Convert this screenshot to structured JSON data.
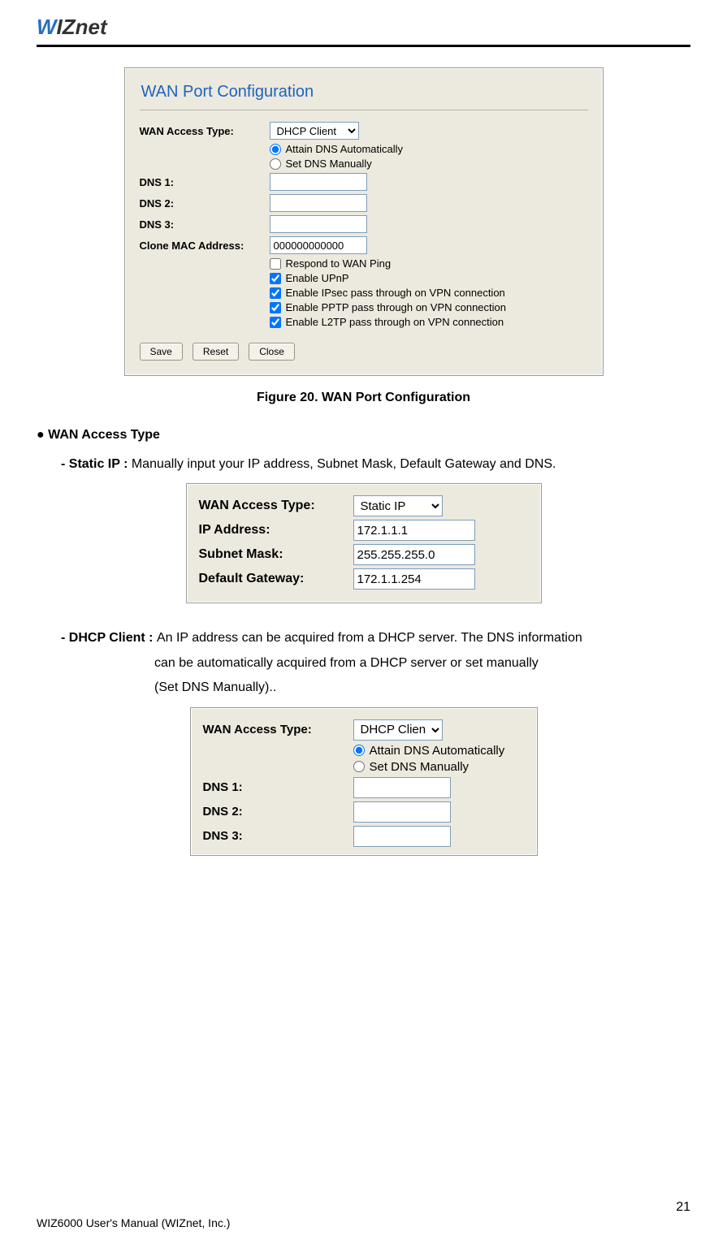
{
  "logo": "WIZnet",
  "figure1": {
    "title": "WAN Port Configuration",
    "rows": {
      "access_label": "WAN Access Type:",
      "access_value": "DHCP Client",
      "radio_auto": "Attain DNS Automatically",
      "radio_manual": "Set DNS Manually",
      "dns1_label": "DNS 1:",
      "dns2_label": "DNS 2:",
      "dns3_label": "DNS 3:",
      "dns1_val": "",
      "dns2_val": "",
      "dns3_val": "",
      "clone_label": "Clone MAC Address:",
      "clone_val": "000000000000",
      "cb_ping": "Respond to WAN Ping",
      "cb_upnp": "Enable UPnP",
      "cb_ipsec": "Enable IPsec pass through on VPN connection",
      "cb_pptp": "Enable PPTP pass through on VPN connection",
      "cb_l2tp": "Enable L2TP pass through on VPN connection"
    },
    "buttons": {
      "save": "Save",
      "reset": "Reset",
      "close": "Close"
    },
    "caption": "Figure 20. WAN Port Configuration"
  },
  "text": {
    "section": "● WAN Access Type",
    "static_lead": "- Static IP : ",
    "static_body": "Manually input your IP address, Subnet Mask, Default Gateway and DNS.",
    "dhcp_lead": "- DHCP Client : ",
    "dhcp_body1": "An IP address can be acquired from a DHCP server. The DNS information",
    "dhcp_body2": "can be automatically acquired from a DHCP server or set manually",
    "dhcp_body3": "(Set DNS Manually).."
  },
  "figure2": {
    "access_label": "WAN Access Type:",
    "access_value": "Static IP",
    "ip_label": "IP Address:",
    "ip_val": "172.1.1.1",
    "mask_label": "Subnet Mask:",
    "mask_val": "255.255.255.0",
    "gw_label": "Default Gateway:",
    "gw_val": "172.1.1.254"
  },
  "figure3": {
    "access_label": "WAN Access Type:",
    "access_value": "DHCP Client",
    "radio_auto": "Attain DNS Automatically",
    "radio_manual": "Set DNS Manually",
    "dns1_label": "DNS 1:",
    "dns2_label": "DNS 2:",
    "dns3_label": "DNS 3:",
    "dns1_val": "",
    "dns2_val": "",
    "dns3_val": ""
  },
  "footer": {
    "left_prefix": "WIZ6000 User's Manual ",
    "left_suffix": "(WIZnet, Inc.)",
    "page": "21"
  }
}
